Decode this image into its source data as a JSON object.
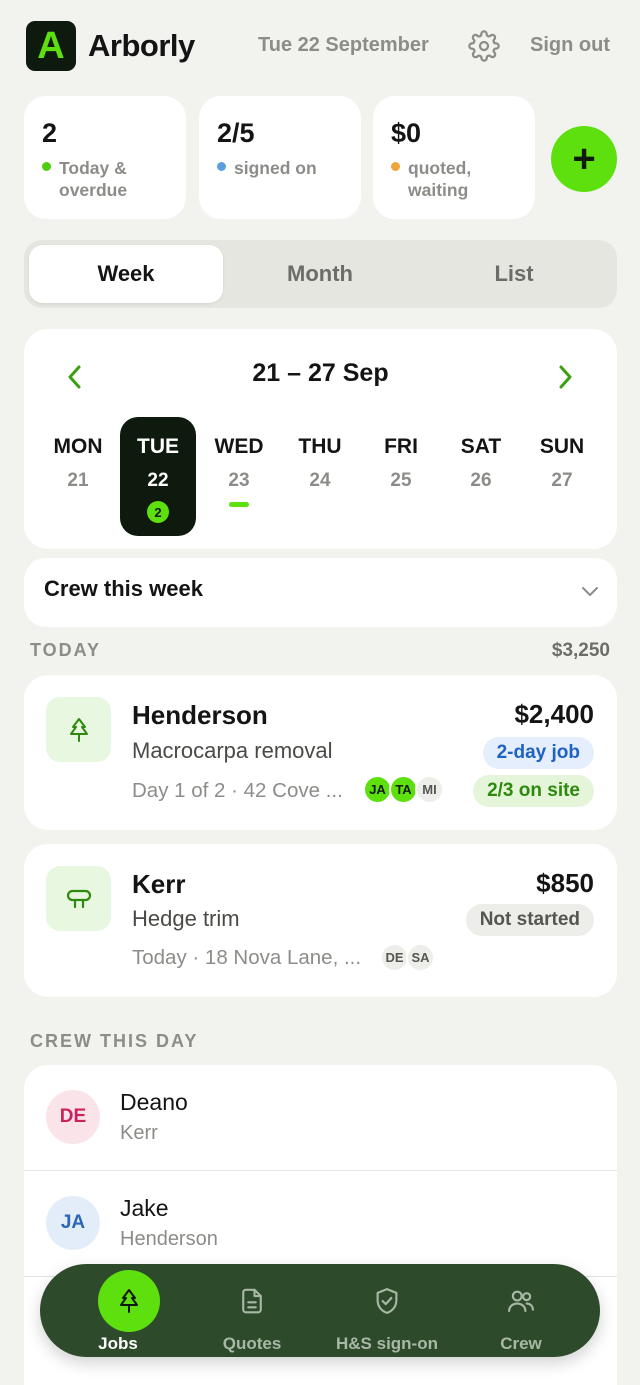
{
  "header": {
    "logo_letter": "A",
    "brand": "Arborly",
    "date": "Tue 22 September",
    "settings_icon": "gear-icon",
    "sign_out": "Sign out"
  },
  "stats": [
    {
      "value": "2",
      "label_line1": "Today &",
      "label_line2": "overdue",
      "dot_color": "#4ccd0f"
    },
    {
      "value": "2/5",
      "label_line1": "signed on",
      "label_line2": "",
      "dot_color": "#5b9fe0"
    },
    {
      "value": "$0",
      "label_line1": "quoted,",
      "label_line2": "waiting",
      "dot_color": "#f0a53a"
    }
  ],
  "fab": {
    "label": "+",
    "icon": "plus-icon"
  },
  "view_tabs": [
    {
      "label": "Week",
      "active": true
    },
    {
      "label": "Month",
      "active": false
    },
    {
      "label": "List",
      "active": false
    }
  ],
  "calendar": {
    "range": "21 – 27 Sep",
    "days": [
      {
        "name": "MON",
        "date": "21"
      },
      {
        "name": "TUE",
        "date": "22",
        "selected": true,
        "count": "2"
      },
      {
        "name": "WED",
        "date": "23",
        "has_jobs_bar": true
      },
      {
        "name": "THU",
        "date": "24"
      },
      {
        "name": "FRI",
        "date": "25"
      },
      {
        "name": "SAT",
        "date": "26"
      },
      {
        "name": "SUN",
        "date": "27"
      }
    ]
  },
  "crew_week": {
    "title": "Crew this week"
  },
  "today": {
    "heading": "TODAY",
    "total": "$3,250",
    "jobs": [
      {
        "client": "Henderson",
        "task": "Macrocarpa removal",
        "meta": "Day 1 of 2 · 42 Cove ...",
        "price": "$2,400",
        "icon": "tree-icon",
        "pills": [
          {
            "text": "2-day job",
            "style": "blue"
          },
          {
            "text": "2/3 on site",
            "style": "green"
          }
        ],
        "crew": [
          {
            "initials": "JA",
            "on_site": true
          },
          {
            "initials": "TA",
            "on_site": true
          },
          {
            "initials": "MI",
            "on_site": false
          }
        ]
      },
      {
        "client": "Kerr",
        "task": "Hedge trim",
        "meta": "Today · 18 Nova Lane, ...",
        "price": "$850",
        "icon": "hedge-trimmer-icon",
        "pills": [
          {
            "text": "Not started",
            "style": "grey"
          }
        ],
        "crew": [
          {
            "initials": "DE",
            "on_site": false
          },
          {
            "initials": "SA",
            "on_site": false
          }
        ]
      }
    ]
  },
  "crew_day": {
    "heading": "CREW THIS DAY",
    "members": [
      {
        "initials": "DE",
        "name": "Deano",
        "job": "Kerr",
        "bg": "#fbe3ea",
        "fg": "#c8235d"
      },
      {
        "initials": "JA",
        "name": "Jake",
        "job": "Henderson",
        "bg": "#e3edf9",
        "fg": "#2a66b8"
      }
    ]
  },
  "nav": [
    {
      "label": "Jobs",
      "icon": "tree-icon",
      "active": true
    },
    {
      "label": "Quotes",
      "icon": "document-icon",
      "active": false
    },
    {
      "label": "H&S sign-on",
      "icon": "shield-check-icon",
      "active": false
    },
    {
      "label": "Crew",
      "icon": "people-icon",
      "active": false
    }
  ]
}
